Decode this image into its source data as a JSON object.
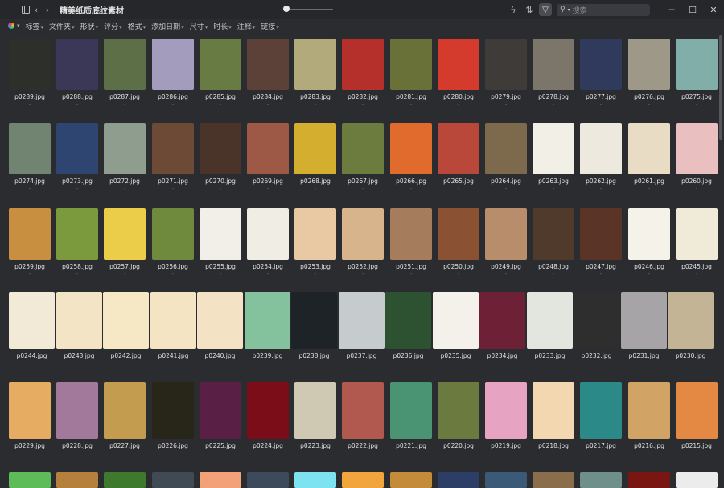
{
  "window": {
    "title": "精美纸质底纹素材",
    "search_placeholder": "搜索",
    "minimize": "─",
    "maximize": "☐",
    "close": "✕"
  },
  "filters": [
    "标签",
    "文件夹",
    "形状",
    "评分",
    "格式",
    "添加日期",
    "尺寸",
    "时长",
    "注释",
    "链接"
  ],
  "rows": [
    {
      "items": [
        {
          "name": "p0289.jpg",
          "color": "#2c2f2a"
        },
        {
          "name": "p0288.jpg",
          "color": "#3b3756"
        },
        {
          "name": "p0287.jpg",
          "color": "#5c6f47"
        },
        {
          "name": "p0286.jpg",
          "color": "#a49cbc"
        },
        {
          "name": "p0285.jpg",
          "color": "#677b42"
        },
        {
          "name": "p0284.jpg",
          "color": "#5b4137"
        },
        {
          "name": "p0283.jpg",
          "color": "#b2aa7b"
        },
        {
          "name": "p0282.jpg",
          "color": "#b52f2b"
        },
        {
          "name": "p0281.jpg",
          "color": "#6a7138"
        },
        {
          "name": "p0280.jpg",
          "color": "#d43b2c"
        },
        {
          "name": "p0279.jpg",
          "color": "#3e3b38"
        },
        {
          "name": "p0278.jpg",
          "color": "#7c766a"
        },
        {
          "name": "p0277.jpg",
          "color": "#2f3a5c"
        },
        {
          "name": "p0276.jpg",
          "color": "#9e9888"
        },
        {
          "name": "p0275.jpg",
          "color": "#82aeaa"
        }
      ]
    },
    {
      "items": [
        {
          "name": "p0274.jpg",
          "color": "#718471"
        },
        {
          "name": "p0273.jpg",
          "color": "#2e4572"
        },
        {
          "name": "p0272.jpg",
          "color": "#8f9d8e"
        },
        {
          "name": "p0271.jpg",
          "color": "#6d4a36"
        },
        {
          "name": "p0270.jpg",
          "color": "#4a3329"
        },
        {
          "name": "p0269.jpg",
          "color": "#9e5846"
        },
        {
          "name": "p0268.jpg",
          "color": "#d4ae2e"
        },
        {
          "name": "p0267.jpg",
          "color": "#6b7c3e"
        },
        {
          "name": "p0266.jpg",
          "color": "#e16b2c"
        },
        {
          "name": "p0265.jpg",
          "color": "#b9473a"
        },
        {
          "name": "p0264.jpg",
          "color": "#7d6a4d"
        },
        {
          "name": "p0263.jpg",
          "color": "#f1efe6"
        },
        {
          "name": "p0262.jpg",
          "color": "#ede9de"
        },
        {
          "name": "p0261.jpg",
          "color": "#e9dcc4"
        },
        {
          "name": "p0260.jpg",
          "color": "#eabfc0"
        }
      ]
    },
    {
      "items": [
        {
          "name": "p0259.jpg",
          "color": "#c98f41"
        },
        {
          "name": "p0258.jpg",
          "color": "#7b9a3e"
        },
        {
          "name": "p0257.jpg",
          "color": "#eccd4a"
        },
        {
          "name": "p0256.jpg",
          "color": "#6f8a3c"
        },
        {
          "name": "p0255.jpg",
          "color": "#f1efe8"
        },
        {
          "name": "p0254.jpg",
          "color": "#efede4"
        },
        {
          "name": "p0253.jpg",
          "color": "#e8c9a3"
        },
        {
          "name": "p0252.jpg",
          "color": "#d8b48d"
        },
        {
          "name": "p0251.jpg",
          "color": "#a57c5c"
        },
        {
          "name": "p0250.jpg",
          "color": "#8a5232"
        },
        {
          "name": "p0249.jpg",
          "color": "#b88d6c"
        },
        {
          "name": "p0248.jpg",
          "color": "#4f3a2c"
        },
        {
          "name": "p0247.jpg",
          "color": "#5a3527"
        },
        {
          "name": "p0246.jpg",
          "color": "#f5f2ea"
        },
        {
          "name": "p0245.jpg",
          "color": "#f0ead8"
        }
      ]
    },
    {
      "items": [
        {
          "name": "p0244.jpg",
          "color": "#f2ead7"
        },
        {
          "name": "p0243.jpg",
          "color": "#f2e4c5"
        },
        {
          "name": "p0242.jpg",
          "color": "#f6e7c5"
        },
        {
          "name": "p0241.jpg",
          "color": "#f4e4c3"
        },
        {
          "name": "p0240.jpg",
          "color": "#f3e3c4"
        },
        {
          "name": "p0239.jpg",
          "color": "#84c29d"
        },
        {
          "name": "p0238.jpg",
          "color": "#1e2328"
        },
        {
          "name": "p0237.jpg",
          "color": "#c6ccce"
        },
        {
          "name": "p0236.jpg",
          "color": "#2d5232"
        },
        {
          "name": "p0235.jpg",
          "color": "#f4f1ea"
        },
        {
          "name": "p0234.jpg",
          "color": "#6e2036"
        },
        {
          "name": "p0233.jpg",
          "color": "#e3e6df"
        },
        {
          "name": "p0232.jpg",
          "color": "#2e2e2e"
        },
        {
          "name": "p0231.jpg",
          "color": "#a7a4a8"
        },
        {
          "name": "p0230.jpg",
          "color": "#c2b494"
        }
      ]
    },
    {
      "items": [
        {
          "name": "p0229.jpg",
          "color": "#e6ad62"
        },
        {
          "name": "p0228.jpg",
          "color": "#a2799a"
        },
        {
          "name": "p0227.jpg",
          "color": "#c39c4f"
        },
        {
          "name": "p0226.jpg",
          "color": "#282519"
        },
        {
          "name": "p0225.jpg",
          "color": "#5a1f45"
        },
        {
          "name": "p0224.jpg",
          "color": "#7a0d18"
        },
        {
          "name": "p0223.jpg",
          "color": "#cfc8b3"
        },
        {
          "name": "p0222.jpg",
          "color": "#b1584f"
        },
        {
          "name": "p0221.jpg",
          "color": "#4b9473"
        },
        {
          "name": "p0220.jpg",
          "color": "#6b7a3e"
        },
        {
          "name": "p0219.jpg",
          "color": "#e6a3c2"
        },
        {
          "name": "p0218.jpg",
          "color": "#f3d7b0"
        },
        {
          "name": "p0217.jpg",
          "color": "#2b8a88"
        },
        {
          "name": "p0216.jpg",
          "color": "#d1a364"
        },
        {
          "name": "p0215.jpg",
          "color": "#e48943"
        }
      ]
    },
    {
      "items": [
        {
          "name": "",
          "color": "#5dbb58"
        },
        {
          "name": "",
          "color": "#b4803b"
        },
        {
          "name": "",
          "color": "#3e7a2d"
        },
        {
          "name": "",
          "color": "#3f4a55"
        },
        {
          "name": "",
          "color": "#f2a178"
        },
        {
          "name": "",
          "color": "#3c4a5c"
        },
        {
          "name": "",
          "color": "#7de3f0"
        },
        {
          "name": "",
          "color": "#f2a53c"
        },
        {
          "name": "",
          "color": "#c38b3a"
        },
        {
          "name": "",
          "color": "#2c3e66"
        },
        {
          "name": "",
          "color": "#3b5a78"
        },
        {
          "name": "",
          "color": "#8a6d4a"
        },
        {
          "name": "",
          "color": "#6f8f8a"
        },
        {
          "name": "",
          "color": "#7a1612"
        },
        {
          "name": "",
          "color": "#ececec"
        }
      ]
    }
  ]
}
